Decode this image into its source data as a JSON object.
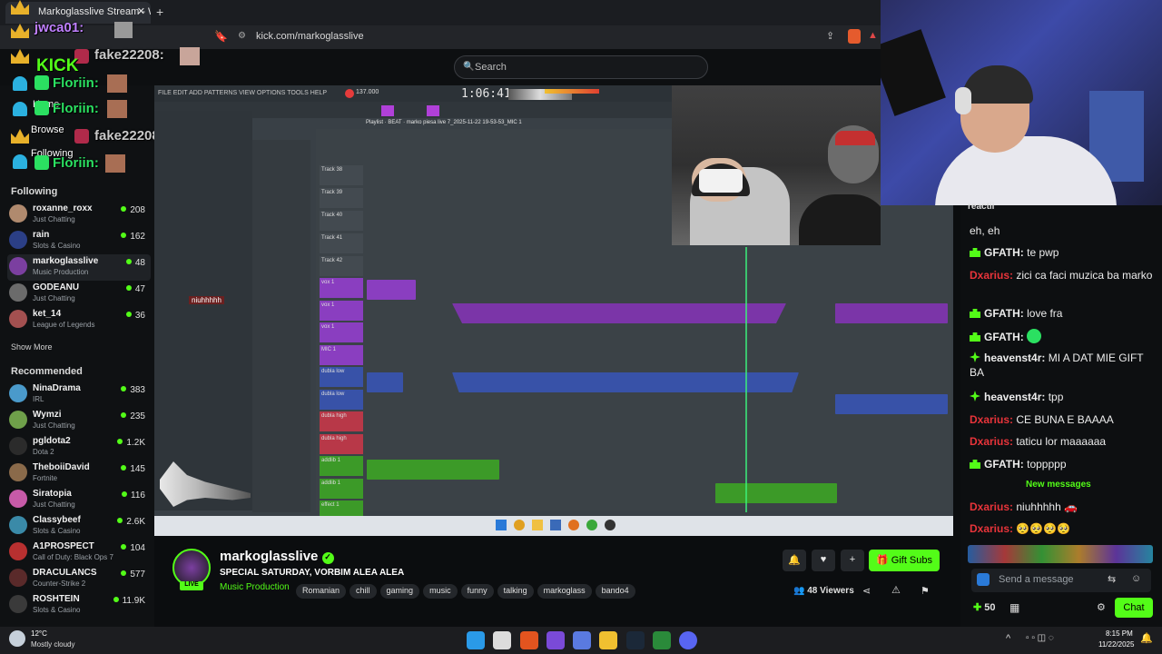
{
  "browser": {
    "tab_title": "Markoglasslive Stream - Wat",
    "url": "kick.com/markoglasslive"
  },
  "header": {
    "search_placeholder": "Search"
  },
  "overlay": {
    "lines": [
      {
        "user": "jwca01:"
      },
      {
        "user": "fake22208:"
      },
      {
        "user": "Floriin:"
      },
      {
        "user": "Floriin:"
      },
      {
        "user": "fake22208:"
      },
      {
        "user": "Floriin:"
      }
    ],
    "kick_logo_text": "KICK",
    "menu_home": "Home",
    "menu_browse": "Browse",
    "menu_following": "Following"
  },
  "sidebar": {
    "following_title": "Following",
    "following": [
      {
        "name": "roxanne_roxx",
        "category": "Just Chatting",
        "viewers": "208",
        "color": "#b08a6e"
      },
      {
        "name": "rain",
        "category": "Slots & Casino",
        "viewers": "162",
        "color": "#2b3f86"
      },
      {
        "name": "markoglasslive",
        "category": "Music Production",
        "viewers": "48",
        "color": "#7b3fa0"
      },
      {
        "name": "GODEANU",
        "category": "Just Chatting",
        "viewers": "47",
        "color": "#6b6b6b"
      },
      {
        "name": "ket_14",
        "category": "League of Legends",
        "viewers": "36",
        "color": "#a35050"
      }
    ],
    "show_more": "Show More",
    "recommended_title": "Recommended",
    "recommended": [
      {
        "name": "NinaDrama",
        "category": "IRL",
        "viewers": "383",
        "color": "#4a9acb"
      },
      {
        "name": "Wymzi",
        "category": "Just Chatting",
        "viewers": "235",
        "color": "#6fa04a"
      },
      {
        "name": "pgldota2",
        "category": "Dota 2",
        "viewers": "1.2K",
        "color": "#2b2b2b"
      },
      {
        "name": "TheboiiDavid",
        "category": "Fortnite",
        "viewers": "145",
        "color": "#8a6a4a"
      },
      {
        "name": "Siratopia",
        "category": "Just Chatting",
        "viewers": "116",
        "color": "#c75aa8"
      },
      {
        "name": "Classybeef",
        "category": "Slots & Casino",
        "viewers": "2.6K",
        "color": "#3a8aa8"
      },
      {
        "name": "A1PROSPECT",
        "category": "Call of Duty: Black Ops 7",
        "viewers": "104",
        "color": "#b83030"
      },
      {
        "name": "DRACULANCS",
        "category": "Counter-Strike 2",
        "viewers": "577",
        "color": "#5a2a2a"
      },
      {
        "name": "ROSHTEIN",
        "category": "Slots & Casino",
        "viewers": "11.9K",
        "color": "#3a3a3a"
      }
    ]
  },
  "daw": {
    "menu": "FILE EDIT ADD PATTERNS VIEW OPTIONS TOOLS HELP",
    "timer": "1:06:41",
    "tempo": "137.000",
    "playlist_title": "Playlist · BEAT · marko piesa live 7_2025-11-22 19-53-53_MIC 1",
    "tracks": [
      "Track 38",
      "Track 39",
      "Track 40",
      "Track 41",
      "Track 42"
    ],
    "channel_labels": [
      "vox 1",
      "vox 1",
      "vox 1",
      "MIC 1",
      "dubla low",
      "dubla low",
      "dubla high",
      "dubla high",
      "addlib 1",
      "addlib 1",
      "effect 1"
    ],
    "chat_overlay_name": "niuhhhhh"
  },
  "stream": {
    "streamer": "markoglasslive",
    "title": "SPECIAL SATURDAY, VORBIM ALEA ALEA",
    "category": "Music Production",
    "tags": [
      "Romanian",
      "chill",
      "gaming",
      "music",
      "funny",
      "talking",
      "markoglass",
      "bando4"
    ],
    "viewers": "48 Viewers",
    "live_badge": "LIVE",
    "gift_subs": "Gift Subs"
  },
  "chat": {
    "top_label": "reactii",
    "messages": [
      {
        "user": "",
        "text": "eh, eh",
        "color": "#ececec",
        "badge": ""
      },
      {
        "user": "GFATH:",
        "text": "te pwp",
        "color": "#ececec",
        "badge": "sub"
      },
      {
        "user": "Dxarius:",
        "text": "zici ca faci muzica ba marko",
        "color": "#e8343a",
        "badge": ""
      },
      {
        "user": "GFATH:",
        "text": "love fra",
        "color": "#ececec",
        "badge": "sub"
      },
      {
        "user": "GFATH:",
        "text": "",
        "color": "#ececec",
        "badge": "sub"
      },
      {
        "user": "heavenst4r:",
        "text": "MI A DAT MIE GIFT BA",
        "color": "#ececec",
        "badge": "star"
      },
      {
        "user": "heavenst4r:",
        "text": "tpp",
        "color": "#ececec",
        "badge": "star"
      },
      {
        "user": "Dxarius:",
        "text": "CE BUNA E BAAAA",
        "color": "#e8343a",
        "badge": ""
      },
      {
        "user": "Dxarius:",
        "text": "taticu lor maaaaaa",
        "color": "#e8343a",
        "badge": ""
      },
      {
        "user": "GFATH:",
        "text": "toppppp",
        "color": "#ececec",
        "badge": "sub"
      }
    ],
    "new_messages": "New messages",
    "after": [
      {
        "user": "Dxarius:",
        "text": "niuhhhhh 🚗"
      },
      {
        "user": "Dxarius:",
        "text": "🥺🥺🥺🥺"
      }
    ],
    "input_placeholder": "Send a message",
    "points": "50",
    "chat_button": "Chat"
  },
  "taskbar": {
    "weather_temp": "12°C",
    "weather_text": "Mostly cloudy",
    "time": "8:15 PM",
    "date": "11/22/2025"
  },
  "colors": {
    "kick_green": "#53fc18",
    "chat_red": "#e8343a"
  }
}
